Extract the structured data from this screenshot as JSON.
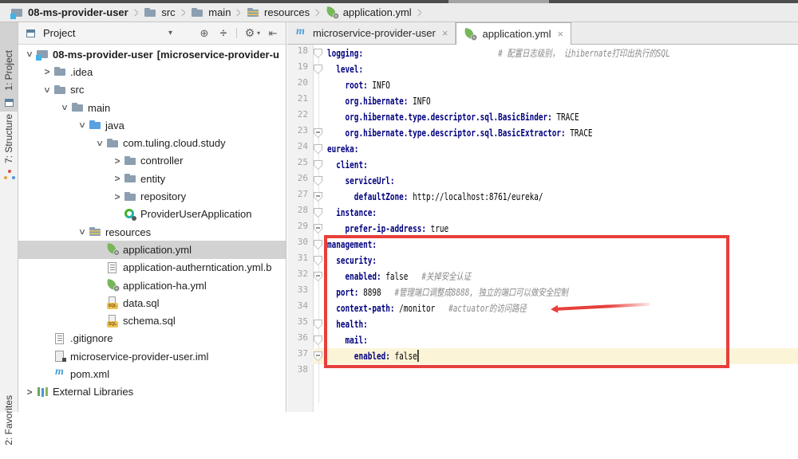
{
  "colors": {
    "accent_red": "#e73f3b",
    "spring_green": "#77b75a",
    "maven_blue": "#4da0d8",
    "yaml_key_blue": "#000080",
    "comment_gray": "#8a8a8a",
    "tree_selected_bg": "#d2d2d2",
    "current_line_bg": "#fcf4d7",
    "panel_bg": "#f2f2f2"
  },
  "breadcrumbs": {
    "items": [
      {
        "label": "08-ms-provider-user",
        "icon": "folder-root",
        "bold": true
      },
      {
        "label": "src",
        "icon": "folder",
        "bold": false
      },
      {
        "label": "main",
        "icon": "folder",
        "bold": false
      },
      {
        "label": "resources",
        "icon": "folder-resources",
        "bold": false
      },
      {
        "label": "application.yml",
        "icon": "spring",
        "bold": false
      }
    ]
  },
  "tool_window_bar": {
    "tabs": [
      {
        "id": "project",
        "label": "1: Project",
        "icon": "project",
        "selected": true
      },
      {
        "id": "structure",
        "label": "7: Structure",
        "icon": "structure",
        "selected": false
      },
      {
        "id": "favorites",
        "label": "2: Favorites",
        "icon": null,
        "selected": false,
        "clipped": true
      }
    ]
  },
  "project_panel": {
    "title": "Project",
    "toolbar_icons": [
      "chevron-down",
      "locate-file",
      "collapse-all",
      "settings-gear",
      "hide-panel"
    ],
    "icon_glyphs": {
      "chevron-down": "▾",
      "locate-file": "⊕",
      "collapse-all": "÷",
      "settings-gear": "⚙",
      "hide-panel": "⇤"
    }
  },
  "tree": {
    "items": [
      {
        "level": 0,
        "chevron": "expanded",
        "icon": "folder-root",
        "label": "08-ms-provider-user",
        "label2": "[microservice-provider-u",
        "bold": true,
        "selected": false
      },
      {
        "level": 1,
        "chevron": "collapsed",
        "icon": "folder",
        "label": ".idea",
        "selected": false
      },
      {
        "level": 1,
        "chevron": "expanded",
        "icon": "folder",
        "label": "src",
        "selected": false
      },
      {
        "level": 2,
        "chevron": "expanded",
        "icon": "folder",
        "label": "main",
        "selected": false
      },
      {
        "level": 3,
        "chevron": "expanded",
        "icon": "folder-java",
        "label": "java",
        "selected": false
      },
      {
        "level": 4,
        "chevron": "expanded",
        "icon": "package",
        "label": "com.tuling.cloud.study",
        "selected": false
      },
      {
        "level": 5,
        "chevron": "collapsed",
        "icon": "package",
        "label": "controller",
        "selected": false
      },
      {
        "level": 5,
        "chevron": "collapsed",
        "icon": "package",
        "label": "entity",
        "selected": false
      },
      {
        "level": 5,
        "chevron": "collapsed",
        "icon": "package",
        "label": "repository",
        "selected": false
      },
      {
        "level": 5,
        "chevron": null,
        "icon": "spring-app",
        "label": "ProviderUserApplication",
        "selected": false
      },
      {
        "level": 3,
        "chevron": "expanded",
        "icon": "folder-resources",
        "label": "resources",
        "selected": false
      },
      {
        "level": 4,
        "chevron": null,
        "icon": "spring",
        "label": "application.yml",
        "selected": true
      },
      {
        "level": 4,
        "chevron": null,
        "icon": "file-text",
        "label": "application-autherntication.yml.b",
        "selected": false
      },
      {
        "level": 4,
        "chevron": null,
        "icon": "spring",
        "label": "application-ha.yml",
        "selected": false
      },
      {
        "level": 4,
        "chevron": null,
        "icon": "sql",
        "label": "data.sql",
        "selected": false
      },
      {
        "level": 4,
        "chevron": null,
        "icon": "sql",
        "label": "schema.sql",
        "selected": false
      },
      {
        "level": 1,
        "chevron": null,
        "icon": "file-text",
        "label": ".gitignore",
        "selected": false
      },
      {
        "level": 1,
        "chevron": null,
        "icon": "file-iml",
        "label": "microservice-provider-user.iml",
        "selected": false
      },
      {
        "level": 1,
        "chevron": null,
        "icon": "maven",
        "label": "pom.xml",
        "selected": false
      },
      {
        "level": 0,
        "chevron": "collapsed",
        "icon": "library",
        "label": "External Libraries",
        "selected": false
      }
    ]
  },
  "editor": {
    "tabs": [
      {
        "label": "microservice-provider-user",
        "icon": "maven",
        "selected": false,
        "close": "×"
      },
      {
        "label": "application.yml",
        "icon": "spring",
        "selected": true,
        "close": "×"
      }
    ],
    "lines": [
      {
        "num": 18,
        "marker": "open",
        "tokens": [
          [
            "key",
            "logging:"
          ],
          [
            "comment",
            "                              # 配置日志级别， 让hibernate打印出执行的SQL"
          ]
        ]
      },
      {
        "num": 19,
        "marker": "open",
        "tokens": [
          [
            "key",
            "  level:"
          ]
        ]
      },
      {
        "num": 20,
        "marker": null,
        "tokens": [
          [
            "key",
            "    root:"
          ],
          [
            "val",
            " INFO"
          ]
        ]
      },
      {
        "num": 21,
        "marker": null,
        "tokens": [
          [
            "key",
            "    org.hibernate:"
          ],
          [
            "val",
            " INFO"
          ]
        ]
      },
      {
        "num": 22,
        "marker": null,
        "tokens": [
          [
            "key",
            "    org.hibernate.type.descriptor.sql.BasicBinder:"
          ],
          [
            "val",
            " TRACE"
          ]
        ]
      },
      {
        "num": 23,
        "marker": "close",
        "tokens": [
          [
            "key",
            "    org.hibernate.type.descriptor.sql.BasicExtractor:"
          ],
          [
            "val",
            " TRACE"
          ]
        ]
      },
      {
        "num": 24,
        "marker": "open",
        "tokens": [
          [
            "key",
            "eureka:"
          ]
        ]
      },
      {
        "num": 25,
        "marker": "open",
        "tokens": [
          [
            "key",
            "  client:"
          ]
        ]
      },
      {
        "num": 26,
        "marker": "open",
        "tokens": [
          [
            "key",
            "    serviceUrl:"
          ]
        ]
      },
      {
        "num": 27,
        "marker": "close",
        "tokens": [
          [
            "key",
            "      defaultZone:"
          ],
          [
            "val",
            " http://localhost:8761/eureka/"
          ]
        ]
      },
      {
        "num": 28,
        "marker": "open",
        "tokens": [
          [
            "key",
            "  instance:"
          ]
        ]
      },
      {
        "num": 29,
        "marker": "close",
        "tokens": [
          [
            "key",
            "    prefer-ip-address:"
          ],
          [
            "val",
            " true"
          ]
        ]
      },
      {
        "num": 30,
        "marker": "open",
        "tokens": [
          [
            "key",
            "management:"
          ]
        ]
      },
      {
        "num": 31,
        "marker": "open",
        "tokens": [
          [
            "key",
            "  security:"
          ]
        ]
      },
      {
        "num": 32,
        "marker": "close",
        "tokens": [
          [
            "key",
            "    enabled:"
          ],
          [
            "val",
            " false"
          ],
          [
            "comment",
            "   #关掉安全认证"
          ]
        ]
      },
      {
        "num": 33,
        "marker": null,
        "tokens": [
          [
            "key",
            "  port:"
          ],
          [
            "val",
            " 8898"
          ],
          [
            "comment",
            "   #管理端口调整成8888, 独立的端口可以做安全控制"
          ]
        ]
      },
      {
        "num": 34,
        "marker": null,
        "tokens": [
          [
            "key",
            "  context-path:"
          ],
          [
            "val",
            " /monitor"
          ],
          [
            "comment",
            "   #actuator的访问路径"
          ]
        ]
      },
      {
        "num": 35,
        "marker": "open",
        "tokens": [
          [
            "key",
            "  health:"
          ]
        ]
      },
      {
        "num": 36,
        "marker": "open",
        "tokens": [
          [
            "key",
            "    mail:"
          ]
        ]
      },
      {
        "num": 37,
        "marker": "close",
        "current": true,
        "cursor": true,
        "tokens": [
          [
            "key",
            "      enabled:"
          ],
          [
            "val",
            " false"
          ]
        ]
      },
      {
        "num": 38,
        "marker": null,
        "tokens": []
      }
    ]
  },
  "annotations": {
    "red_box": true,
    "red_arrow": true,
    "arrow_points_to_line": 34
  }
}
